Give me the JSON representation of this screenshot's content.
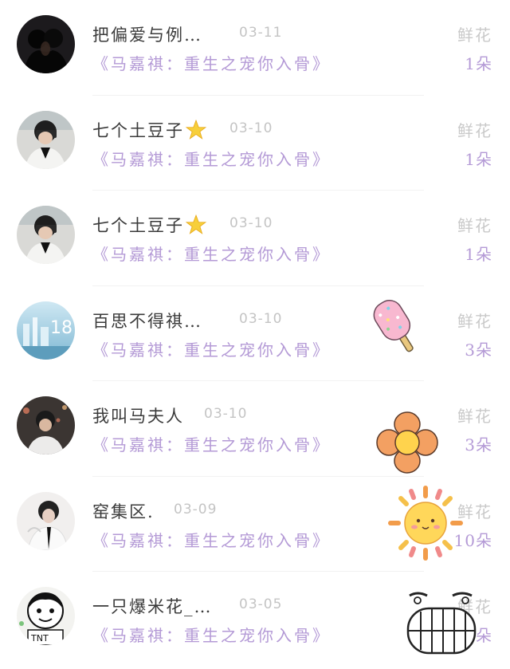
{
  "rows": [
    {
      "name": "把偏爱与例…",
      "date": "03-11",
      "book": "《马嘉祺：重生之宠你入骨》",
      "flower_label": "鲜花",
      "count": "1朵",
      "avatar": "couple-silhouette"
    },
    {
      "name": "七个土豆子",
      "date": "03-10",
      "book": "《马嘉祺：重生之宠你入骨》",
      "flower_label": "鲜花",
      "count": "1朵",
      "avatar": "boy-mirror-selfie",
      "badge": "star-emoji"
    },
    {
      "name": "七个土豆子",
      "date": "03-10",
      "book": "《马嘉祺：重生之宠你入骨》",
      "flower_label": "鲜花",
      "count": "1朵",
      "avatar": "boy-mirror-selfie",
      "badge": "star-emoji"
    },
    {
      "name": "百思不得祺…",
      "date": "03-10",
      "book": "《马嘉祺：重生之宠你入骨》",
      "flower_label": "鲜花",
      "count": "3朵",
      "avatar": "blue-scenery",
      "sticker": "popsicle-sticker"
    },
    {
      "name": "我叫马夫人",
      "date": "03-10",
      "book": "《马嘉祺：重生之宠你入骨》",
      "flower_label": "鲜花",
      "count": "3朵",
      "avatar": "boy-street",
      "sticker": "orange-flower-sticker"
    },
    {
      "name": "窑集区.",
      "date": "03-09",
      "book": "《马嘉祺：重生之宠你入骨》",
      "flower_label": "鲜花",
      "count": "10朵",
      "avatar": "boy-tie",
      "sticker": "sun-sticker"
    },
    {
      "name": "一只爆米花_…",
      "date": "03-05",
      "book": "《马嘉祺：重生之宠你入骨》",
      "flower_label": "鲜花",
      "count": "3朵",
      "avatar": "cartoon-tnt",
      "sticker": "grin-face-sticker"
    }
  ]
}
